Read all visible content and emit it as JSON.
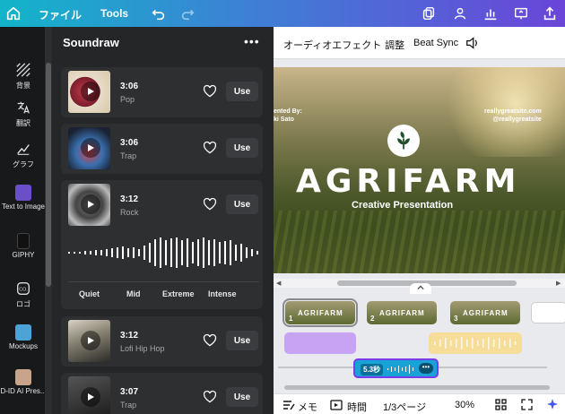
{
  "topbar": {
    "file_label": "ファイル",
    "tools_label": "Tools"
  },
  "rail": [
    {
      "label": "背景",
      "icon": "pattern-icon"
    },
    {
      "label": "翻訳",
      "icon": "translate-icon"
    },
    {
      "label": "グラフ",
      "icon": "chart-line-icon"
    },
    {
      "label": "Text to Image",
      "icon": "text-to-image-icon"
    },
    {
      "label": "GIPHY",
      "icon": "giphy-icon"
    },
    {
      "label": "ロゴ",
      "icon": "logo-icon"
    },
    {
      "label": "Mockups",
      "icon": "mockups-icon"
    },
    {
      "label": "D-ID AI Pres...",
      "icon": "did-avatar-icon"
    }
  ],
  "panel": {
    "title": "Soundraw",
    "more": "•••",
    "use_label": "Use",
    "tracks": [
      {
        "time": "3:06",
        "genre": "Pop"
      },
      {
        "time": "3:06",
        "genre": "Trap"
      },
      {
        "time": "3:12",
        "genre": "Rock"
      },
      {
        "time": "3:12",
        "genre": "Lofi Hip Hop"
      },
      {
        "time": "3:07",
        "genre": "Trap"
      }
    ],
    "intensity": [
      "Quiet",
      "Mid",
      "Extreme",
      "Intense"
    ]
  },
  "context_bar": {
    "audio_effects": "オーディオエフェクト",
    "adjust": "調整",
    "beat_sync": "Beat Sync"
  },
  "canvas": {
    "title": "AGRIFARM",
    "subtitle": "Creative Presentation",
    "presented_line1": "ented By:",
    "presented_line2": "ki Sato",
    "site_line1": "reallygreatsite.com",
    "site_line2": "@reallygreatsite"
  },
  "timeline": {
    "pages": [
      {
        "num": "1",
        "title": "AGRIFARM"
      },
      {
        "num": "2",
        "title": "AGRIFARM"
      },
      {
        "num": "3",
        "title": "AGRIFARM"
      }
    ],
    "selected_audio_label": "5.3秒",
    "selected_audio_more": "•••"
  },
  "bottombar": {
    "memo": "メモ",
    "time": "時間",
    "pages": "1/3ページ",
    "zoom": "30%"
  },
  "colors": {
    "accent_purple": "#7b3bea",
    "audio_cyan": "#17a3d6",
    "audio_purple": "#c9a3f3",
    "audio_yellow": "#f6dd9a"
  }
}
